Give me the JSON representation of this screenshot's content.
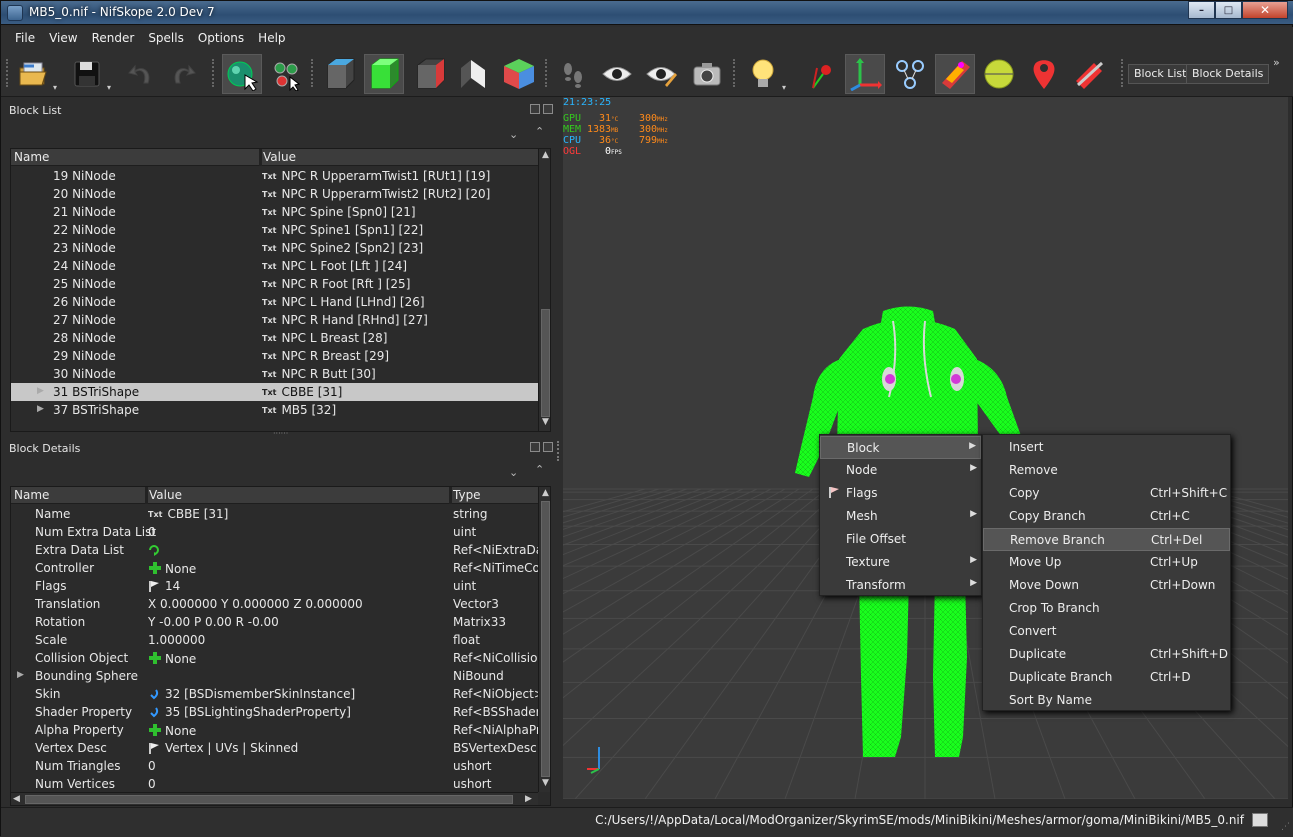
{
  "window": {
    "title": "MB5_0.nif - NifSkope 2.0 Dev 7",
    "min": "–",
    "max": "□",
    "close": "✕"
  },
  "menu": [
    "File",
    "View",
    "Render",
    "Spells",
    "Options",
    "Help"
  ],
  "toolbar": {
    "block_list_btn": "Block List",
    "block_details_btn": "Block Details",
    "overflow": "»"
  },
  "block_list": {
    "title": "Block List",
    "columns": [
      "Name",
      "Value"
    ],
    "rows": [
      {
        "name": "19 NiNode",
        "value": "NPC R UpperarmTwist1 [RUt1] [19]"
      },
      {
        "name": "20 NiNode",
        "value": "NPC R UpperarmTwist2 [RUt2] [20]"
      },
      {
        "name": "21 NiNode",
        "value": "NPC Spine [Spn0] [21]"
      },
      {
        "name": "22 NiNode",
        "value": "NPC Spine1 [Spn1] [22]"
      },
      {
        "name": "23 NiNode",
        "value": "NPC Spine2 [Spn2] [23]"
      },
      {
        "name": "24 NiNode",
        "value": "NPC L Foot [Lft ] [24]"
      },
      {
        "name": "25 NiNode",
        "value": "NPC R Foot [Rft ] [25]"
      },
      {
        "name": "26 NiNode",
        "value": "NPC L Hand [LHnd] [26]"
      },
      {
        "name": "27 NiNode",
        "value": "NPC R Hand [RHnd] [27]"
      },
      {
        "name": "28 NiNode",
        "value": "NPC L Breast [28]"
      },
      {
        "name": "29 NiNode",
        "value": "NPC R Breast [29]"
      },
      {
        "name": "30 NiNode",
        "value": "NPC R Butt [30]"
      },
      {
        "name": "31 BSTriShape",
        "value": "CBBE [31]"
      },
      {
        "name": "37 BSTriShape",
        "value": "MB5 [32]"
      }
    ],
    "txt_icon": "Txt"
  },
  "block_details": {
    "title": "Block Details",
    "columns": [
      "Name",
      "Value",
      "Type"
    ],
    "rows": [
      {
        "name": "Name",
        "value": "CBBE [31]",
        "type": "string",
        "icon": "txt"
      },
      {
        "name": "Num Extra Data List",
        "value": "0",
        "type": "uint",
        "icon": ""
      },
      {
        "name": "Extra Data List",
        "value": "",
        "type": "Ref<NiExtraData",
        "icon": "refresh"
      },
      {
        "name": "Controller",
        "value": "None",
        "type": "Ref<NiTimeCo...",
        "icon": "plus"
      },
      {
        "name": "Flags",
        "value": "14",
        "type": "uint",
        "icon": "flag"
      },
      {
        "name": "Translation",
        "value": "X 0.000000 Y 0.000000 Z 0.000000",
        "type": "Vector3",
        "icon": ""
      },
      {
        "name": "Rotation",
        "value": "Y -0.00 P 0.00 R -0.00",
        "type": "Matrix33",
        "icon": ""
      },
      {
        "name": "Scale",
        "value": "1.000000",
        "type": "float",
        "icon": ""
      },
      {
        "name": "Collision Object",
        "value": "None",
        "type": "Ref<NiCollision",
        "icon": "plus"
      },
      {
        "name": "Bounding Sphere",
        "value": "",
        "type": "NiBound",
        "icon": ""
      },
      {
        "name": "Skin",
        "value": "32 [BSDismemberSkinInstance]",
        "type": "Ref<NiObject>",
        "icon": "link"
      },
      {
        "name": "Shader Property",
        "value": "35 [BSLightingShaderProperty]",
        "type": "Ref<BSShaderP...",
        "icon": "link"
      },
      {
        "name": "Alpha Property",
        "value": "None",
        "type": "Ref<NiAlphaPr...",
        "icon": "plus"
      },
      {
        "name": "Vertex Desc",
        "value": "Vertex | UVs | Skinned",
        "type": "BSVertexDesc",
        "icon": "flag"
      },
      {
        "name": "Num Triangles",
        "value": "0",
        "type": "ushort",
        "icon": ""
      },
      {
        "name": "Num Vertices",
        "value": "0",
        "type": "ushort",
        "icon": ""
      }
    ]
  },
  "hud": {
    "time": "21:23:25",
    "gpu_label": "GPU",
    "gpu_val": "31",
    "gpu_unit": "°C",
    "gpu_clk": "300",
    "gpu_clk_unit": "MHz",
    "mem_label": "MEM",
    "mem_val": "1383",
    "mem_unit": "MB",
    "mem_clk": "300",
    "mem_clk_unit": "MHz",
    "cpu_label": "CPU",
    "cpu_val": "36",
    "cpu_unit": "°C",
    "cpu_clk": "799",
    "cpu_clk_unit": "MHz",
    "ogl_label": "OGL",
    "ogl_val": "0",
    "ogl_unit": "FPS"
  },
  "context_menu": {
    "items": [
      {
        "label": "Block",
        "submenu": true
      },
      {
        "label": "Node",
        "submenu": true
      },
      {
        "label": "Flags",
        "submenu": false
      },
      {
        "label": "Mesh",
        "submenu": true
      },
      {
        "label": "File Offset",
        "submenu": false
      },
      {
        "label": "Texture",
        "submenu": true
      },
      {
        "label": "Transform",
        "submenu": true
      }
    ],
    "submenu": [
      {
        "label": "Insert",
        "shortcut": ""
      },
      {
        "label": "Remove",
        "shortcut": ""
      },
      {
        "label": "Copy",
        "shortcut": "Ctrl+Shift+C"
      },
      {
        "label": "Copy Branch",
        "shortcut": "Ctrl+C"
      },
      {
        "label": "Remove Branch",
        "shortcut": "Ctrl+Del"
      },
      {
        "label": "Move Up",
        "shortcut": "Ctrl+Up"
      },
      {
        "label": "Move Down",
        "shortcut": "Ctrl+Down"
      },
      {
        "label": "Crop To Branch",
        "shortcut": ""
      },
      {
        "label": "Convert",
        "shortcut": ""
      },
      {
        "label": "Duplicate",
        "shortcut": "Ctrl+Shift+D"
      },
      {
        "label": "Duplicate Branch",
        "shortcut": "Ctrl+D"
      },
      {
        "label": "Sort By Name",
        "shortcut": ""
      }
    ]
  },
  "status": {
    "path": "C:/Users/!/AppData/Local/ModOrganizer/SkyrimSE/mods/MiniBikini/Meshes/armor/goma/MiniBikini/MB5_0.nif"
  },
  "colors": {
    "mesh": "#19ff1d",
    "viewport_bg": "#3b3b3b",
    "selection": "#c8c8c8",
    "hud_green": "#34c81e",
    "hud_orange": "#ff8a1a",
    "hud_cyan": "#29b6ff",
    "hud_red": "#ff3a3a"
  }
}
